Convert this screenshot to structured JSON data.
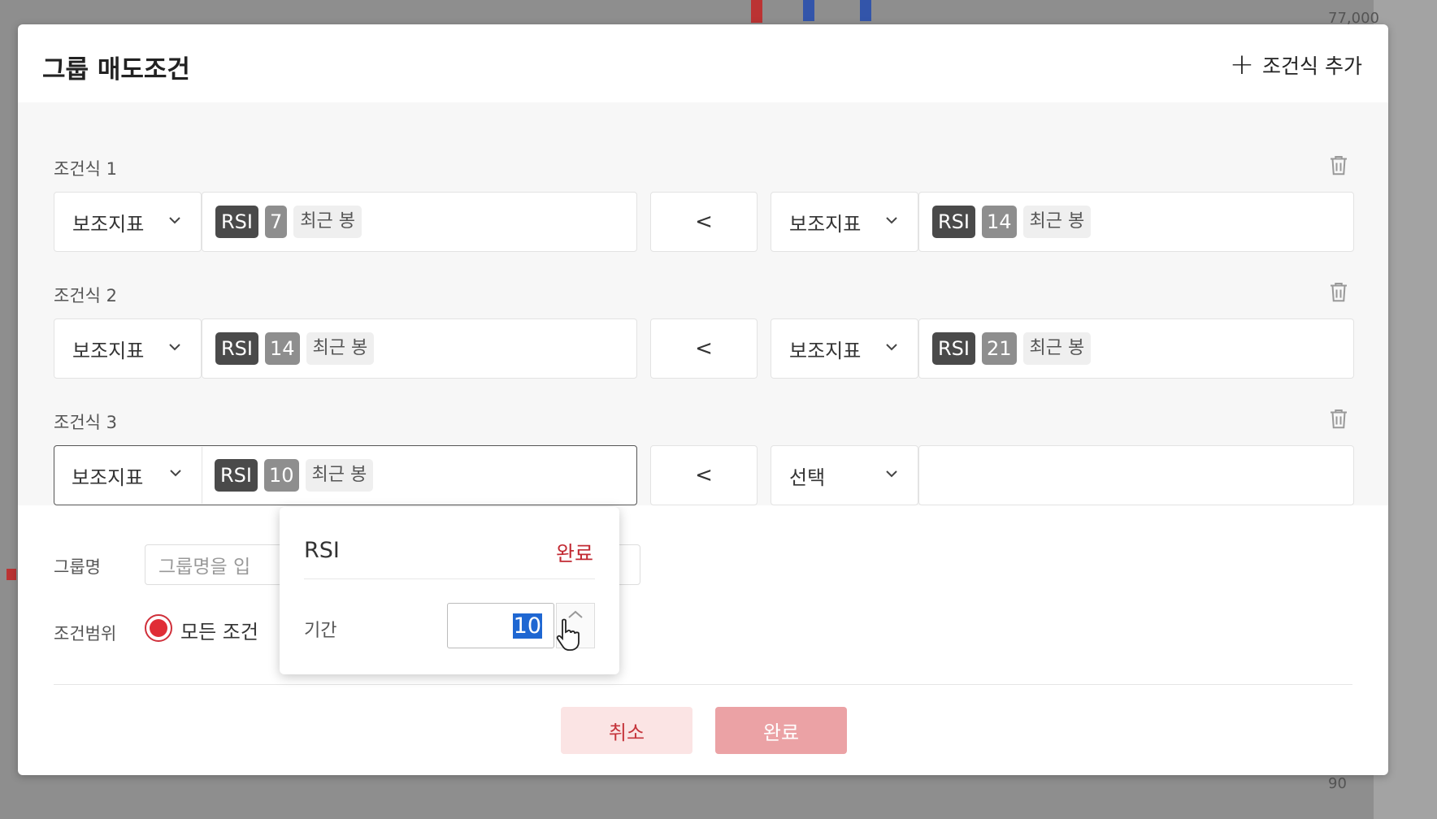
{
  "background": {
    "ticks": [
      "77,000",
      "90"
    ]
  },
  "dialog": {
    "title": "그룹 매도조건",
    "add_condition_label": "조건식 추가",
    "conditions": [
      {
        "label": "조건식 1",
        "left_type": "보조지표",
        "left_indicator": "RSI",
        "left_period": "7",
        "left_bar": "최근 봉",
        "operator": "<",
        "right_type": "보조지표",
        "right_indicator": "RSI",
        "right_period": "14",
        "right_bar": "최근 봉"
      },
      {
        "label": "조건식 2",
        "left_type": "보조지표",
        "left_indicator": "RSI",
        "left_period": "14",
        "left_bar": "최근 봉",
        "operator": "<",
        "right_type": "보조지표",
        "right_indicator": "RSI",
        "right_period": "21",
        "right_bar": "최근 봉"
      },
      {
        "label": "조건식 3",
        "left_type": "보조지표",
        "left_indicator": "RSI",
        "left_period": "10",
        "left_bar": "최근 봉",
        "operator": "<",
        "right_type": "선택"
      }
    ],
    "group_name_label": "그룹명",
    "group_name_placeholder": "그룹명을 입",
    "scope_label": "조건범위",
    "scope_option": "모든 조건",
    "cancel_label": "취소",
    "done_label": "완료"
  },
  "popover": {
    "title": "RSI",
    "done_label": "완료",
    "period_label": "기간",
    "period_value": "10"
  },
  "colors": {
    "accent_red": "#e02d36",
    "done_button": "#eba2a5",
    "cancel_button_bg": "#fbe4e4",
    "tag_dark": "#4a4a4a",
    "tag_grey": "#8e8e8e"
  }
}
